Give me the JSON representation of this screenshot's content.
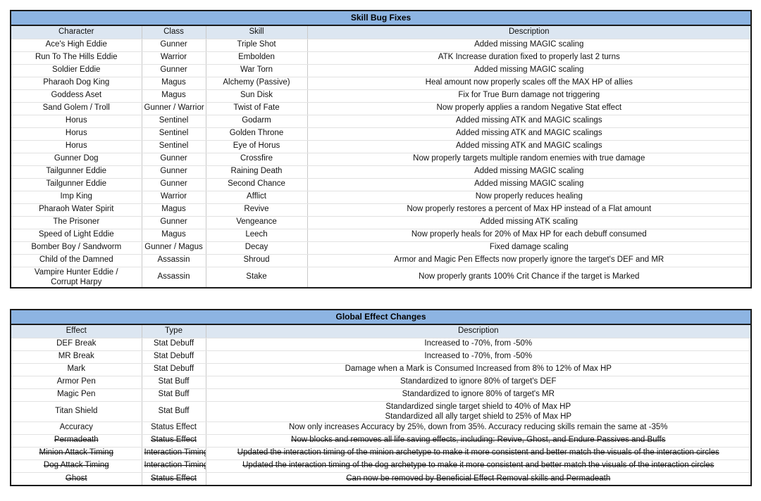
{
  "colors": {
    "title_bar": "#8DB4E2",
    "column_header": "#DCE6F1",
    "text_default": "#111111",
    "text_blue": "#5B7FD4",
    "text_red_strikethrough": "#FE3B30",
    "border": "#1A1A1A"
  },
  "tables": [
    {
      "id": "skill-bug-fixes",
      "title": "Skill Bug Fixes",
      "columns": [
        "Character",
        "Class",
        "Skill",
        "Description"
      ],
      "rows": [
        {
          "style": "default",
          "cells": [
            "Ace's High Eddie",
            "Gunner",
            "Triple Shot",
            "Added missing MAGIC scaling"
          ]
        },
        {
          "style": "default",
          "cells": [
            "Run To The Hills Eddie",
            "Warrior",
            "Embolden",
            "ATK Increase duration fixed to properly last 2 turns"
          ]
        },
        {
          "style": "default",
          "cells": [
            "Soldier Eddie",
            "Gunner",
            "War Torn",
            "Added missing MAGIC scaling"
          ]
        },
        {
          "style": "default",
          "cells": [
            "Pharaoh Dog King",
            "Magus",
            "Alchemy (Passive)",
            "Heal amount now properly scales off the MAX HP of allies"
          ]
        },
        {
          "style": "default",
          "cells": [
            "Goddess Aset",
            "Magus",
            "Sun Disk",
            "Fix for True Burn damage not triggering"
          ]
        },
        {
          "style": "default",
          "cells": [
            "Sand Golem / Troll",
            "Gunner / Warrior",
            "Twist of Fate",
            "Now properly applies a random Negative Stat effect"
          ]
        },
        {
          "style": "default",
          "cells": [
            "Horus",
            "Sentinel",
            "Godarm",
            "Added missing ATK and MAGIC scalings"
          ]
        },
        {
          "style": "default",
          "cells": [
            "Horus",
            "Sentinel",
            "Golden Throne",
            "Added missing ATK and MAGIC scalings"
          ]
        },
        {
          "style": "default",
          "cells": [
            "Horus",
            "Sentinel",
            "Eye of Horus",
            "Added missing ATK and MAGIC scalings"
          ]
        },
        {
          "style": "default",
          "cells": [
            "Gunner Dog",
            "Gunner",
            "Crossfire",
            "Now properly targets multiple random enemies with true damage"
          ]
        },
        {
          "style": "default",
          "cells": [
            "Tailgunner Eddie",
            "Gunner",
            "Raining Death",
            "Added missing MAGIC scaling"
          ]
        },
        {
          "style": "default",
          "cells": [
            "Tailgunner Eddie",
            "Gunner",
            "Second Chance",
            "Added missing MAGIC scaling"
          ]
        },
        {
          "style": "default",
          "cells": [
            "Imp King",
            "Warrior",
            "Afflict",
            "Now properly reduces healing"
          ]
        },
        {
          "style": "blue",
          "cells": [
            "Pharaoh Water Spirit",
            "Magus",
            "Revive",
            "Now properly restores a percent of Max HP instead of a Flat amount"
          ]
        },
        {
          "style": "blue",
          "cells": [
            "The Prisoner",
            "Gunner",
            "Vengeance",
            "Added missing ATK scaling"
          ]
        },
        {
          "style": "blue",
          "cells": [
            "Speed of Light Eddie",
            "Magus",
            "Leech",
            "Now properly heals for 20% of Max HP for each debuff consumed"
          ]
        },
        {
          "style": "blue",
          "cells": [
            "Bomber Boy / Sandworm",
            "Gunner / Magus",
            "Decay",
            "Fixed damage scaling"
          ]
        },
        {
          "style": "blue",
          "cells": [
            "Child of the Damned",
            "Assassin",
            "Shroud",
            "Armor and Magic Pen Effects now properly ignore the target's DEF and MR"
          ]
        },
        {
          "style": "blue",
          "two_line": true,
          "cells": [
            [
              "Vampire Hunter Eddie /",
              "Corrupt Harpy"
            ],
            "Assassin",
            "Stake",
            "Now properly grants 100% Crit Chance if the target is Marked"
          ]
        }
      ]
    },
    {
      "id": "global-effect-changes",
      "title": "Global Effect Changes",
      "columns": [
        "Effect",
        "Type",
        "Description"
      ],
      "rows": [
        {
          "style": "default",
          "cells": [
            "DEF Break",
            "Stat Debuff",
            "Increased to -70%, from -50%"
          ]
        },
        {
          "style": "default",
          "cells": [
            "MR Break",
            "Stat Debuff",
            "Increased to -70%, from -50%"
          ]
        },
        {
          "style": "default",
          "cells": [
            "Mark",
            "Stat Debuff",
            "Damage when a Mark is Consumed Increased from 8% to 12% of Max HP"
          ]
        },
        {
          "style": "blue",
          "cells": [
            "Armor Pen",
            "Stat Buff",
            "Standardized to ignore 80% of target's DEF"
          ]
        },
        {
          "style": "blue",
          "cells": [
            "Magic Pen",
            "Stat Buff",
            "Standardized to ignore 80% of target's MR"
          ]
        },
        {
          "style": "blue",
          "two_line": true,
          "cells": [
            "Titan Shield",
            "Stat Buff",
            [
              "Standardized single target shield to 40% of Max HP",
              "Standardized all ally target shield to 25% of Max HP"
            ]
          ]
        },
        {
          "style": "default",
          "cells": [
            "Accuracy",
            "Status Effect",
            "Now only increases Accuracy by 25%, down from 35%. Accuracy reducing skills remain the same at -35%"
          ]
        },
        {
          "style": "red",
          "cells": [
            "Permadeath",
            "Status Effect",
            "Now blocks and removes all life saving effects, including: Revive, Ghost, and Endure Passives and Buffs"
          ]
        },
        {
          "style": "red",
          "cells": [
            "Minion Attack Timing",
            "Interaction Timing",
            "Updated the interaction timing of the minion archetype to make it more consistent and better match the visuals of the interaction circles"
          ]
        },
        {
          "style": "red",
          "cells": [
            "Dog Attack Timing",
            "Interaction Timing",
            "Updated the interaction timing of the dog archetype to make it more consistent and better match the visuals of the interaction circles"
          ]
        },
        {
          "style": "red",
          "cells": [
            "Ghost",
            "Status Effect",
            "Can now be removed by Beneficial Effect Removal skills and Permadeath"
          ]
        }
      ]
    }
  ]
}
